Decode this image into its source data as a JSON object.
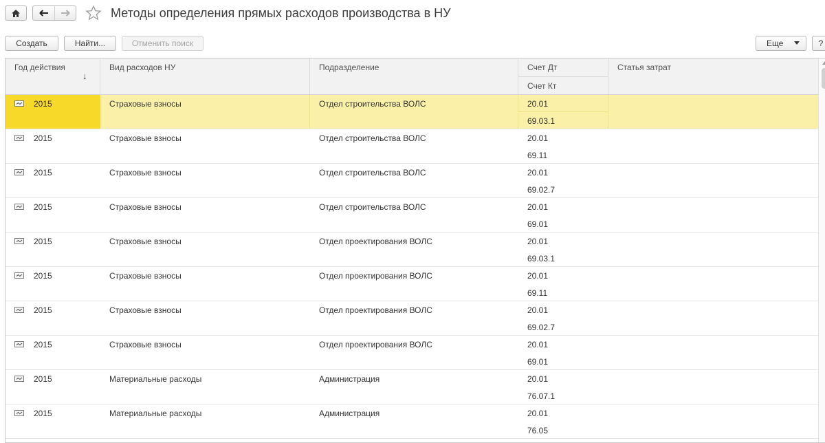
{
  "window": {
    "title": "Методы определения прямых расходов производства в НУ"
  },
  "toolbar": {
    "create_label": "Создать",
    "find_label": "Найти...",
    "cancel_search_label": "Отменить поиск",
    "more_label": "Еще",
    "help_label": "?"
  },
  "table": {
    "columns": {
      "year": "Год действия",
      "sort_indicator": "↓",
      "kind": "Вид расходов НУ",
      "dept": "Подразделение",
      "debit": "Счет Дт",
      "credit": "Счет Кт",
      "item": "Статья затрат"
    },
    "rows": [
      {
        "year": "2015",
        "kind": "Страховые взносы",
        "dept": "Отдел строительства ВОЛС",
        "dt": "20.01",
        "kt": "69.03.1",
        "item": "",
        "selected": true
      },
      {
        "year": "2015",
        "kind": "Страховые взносы",
        "dept": "Отдел строительства ВОЛС",
        "dt": "20.01",
        "kt": "69.11",
        "item": ""
      },
      {
        "year": "2015",
        "kind": "Страховые взносы",
        "dept": "Отдел строительства ВОЛС",
        "dt": "20.01",
        "kt": "69.02.7",
        "item": ""
      },
      {
        "year": "2015",
        "kind": "Страховые взносы",
        "dept": "Отдел строительства ВОЛС",
        "dt": "20.01",
        "kt": "69.01",
        "item": ""
      },
      {
        "year": "2015",
        "kind": "Страховые взносы",
        "dept": "Отдел проектирования ВОЛС",
        "dt": "20.01",
        "kt": "69.03.1",
        "item": ""
      },
      {
        "year": "2015",
        "kind": "Страховые взносы",
        "dept": "Отдел проектирования ВОЛС",
        "dt": "20.01",
        "kt": "69.11",
        "item": ""
      },
      {
        "year": "2015",
        "kind": "Страховые взносы",
        "dept": "Отдел проектирования ВОЛС",
        "dt": "20.01",
        "kt": "69.02.7",
        "item": ""
      },
      {
        "year": "2015",
        "kind": "Страховые взносы",
        "dept": "Отдел проектирования ВОЛС",
        "dt": "20.01",
        "kt": "69.01",
        "item": ""
      },
      {
        "year": "2015",
        "kind": "Материальные расходы",
        "dept": "Администрация",
        "dt": "20.01",
        "kt": "76.07.1",
        "item": ""
      },
      {
        "year": "2015",
        "kind": "Материальные расходы",
        "dept": "Администрация",
        "dt": "20.01",
        "kt": "76.05",
        "item": ""
      }
    ]
  },
  "colors": {
    "selected_row": "#fbf0a8",
    "selected_cell": "#f7d92a"
  }
}
